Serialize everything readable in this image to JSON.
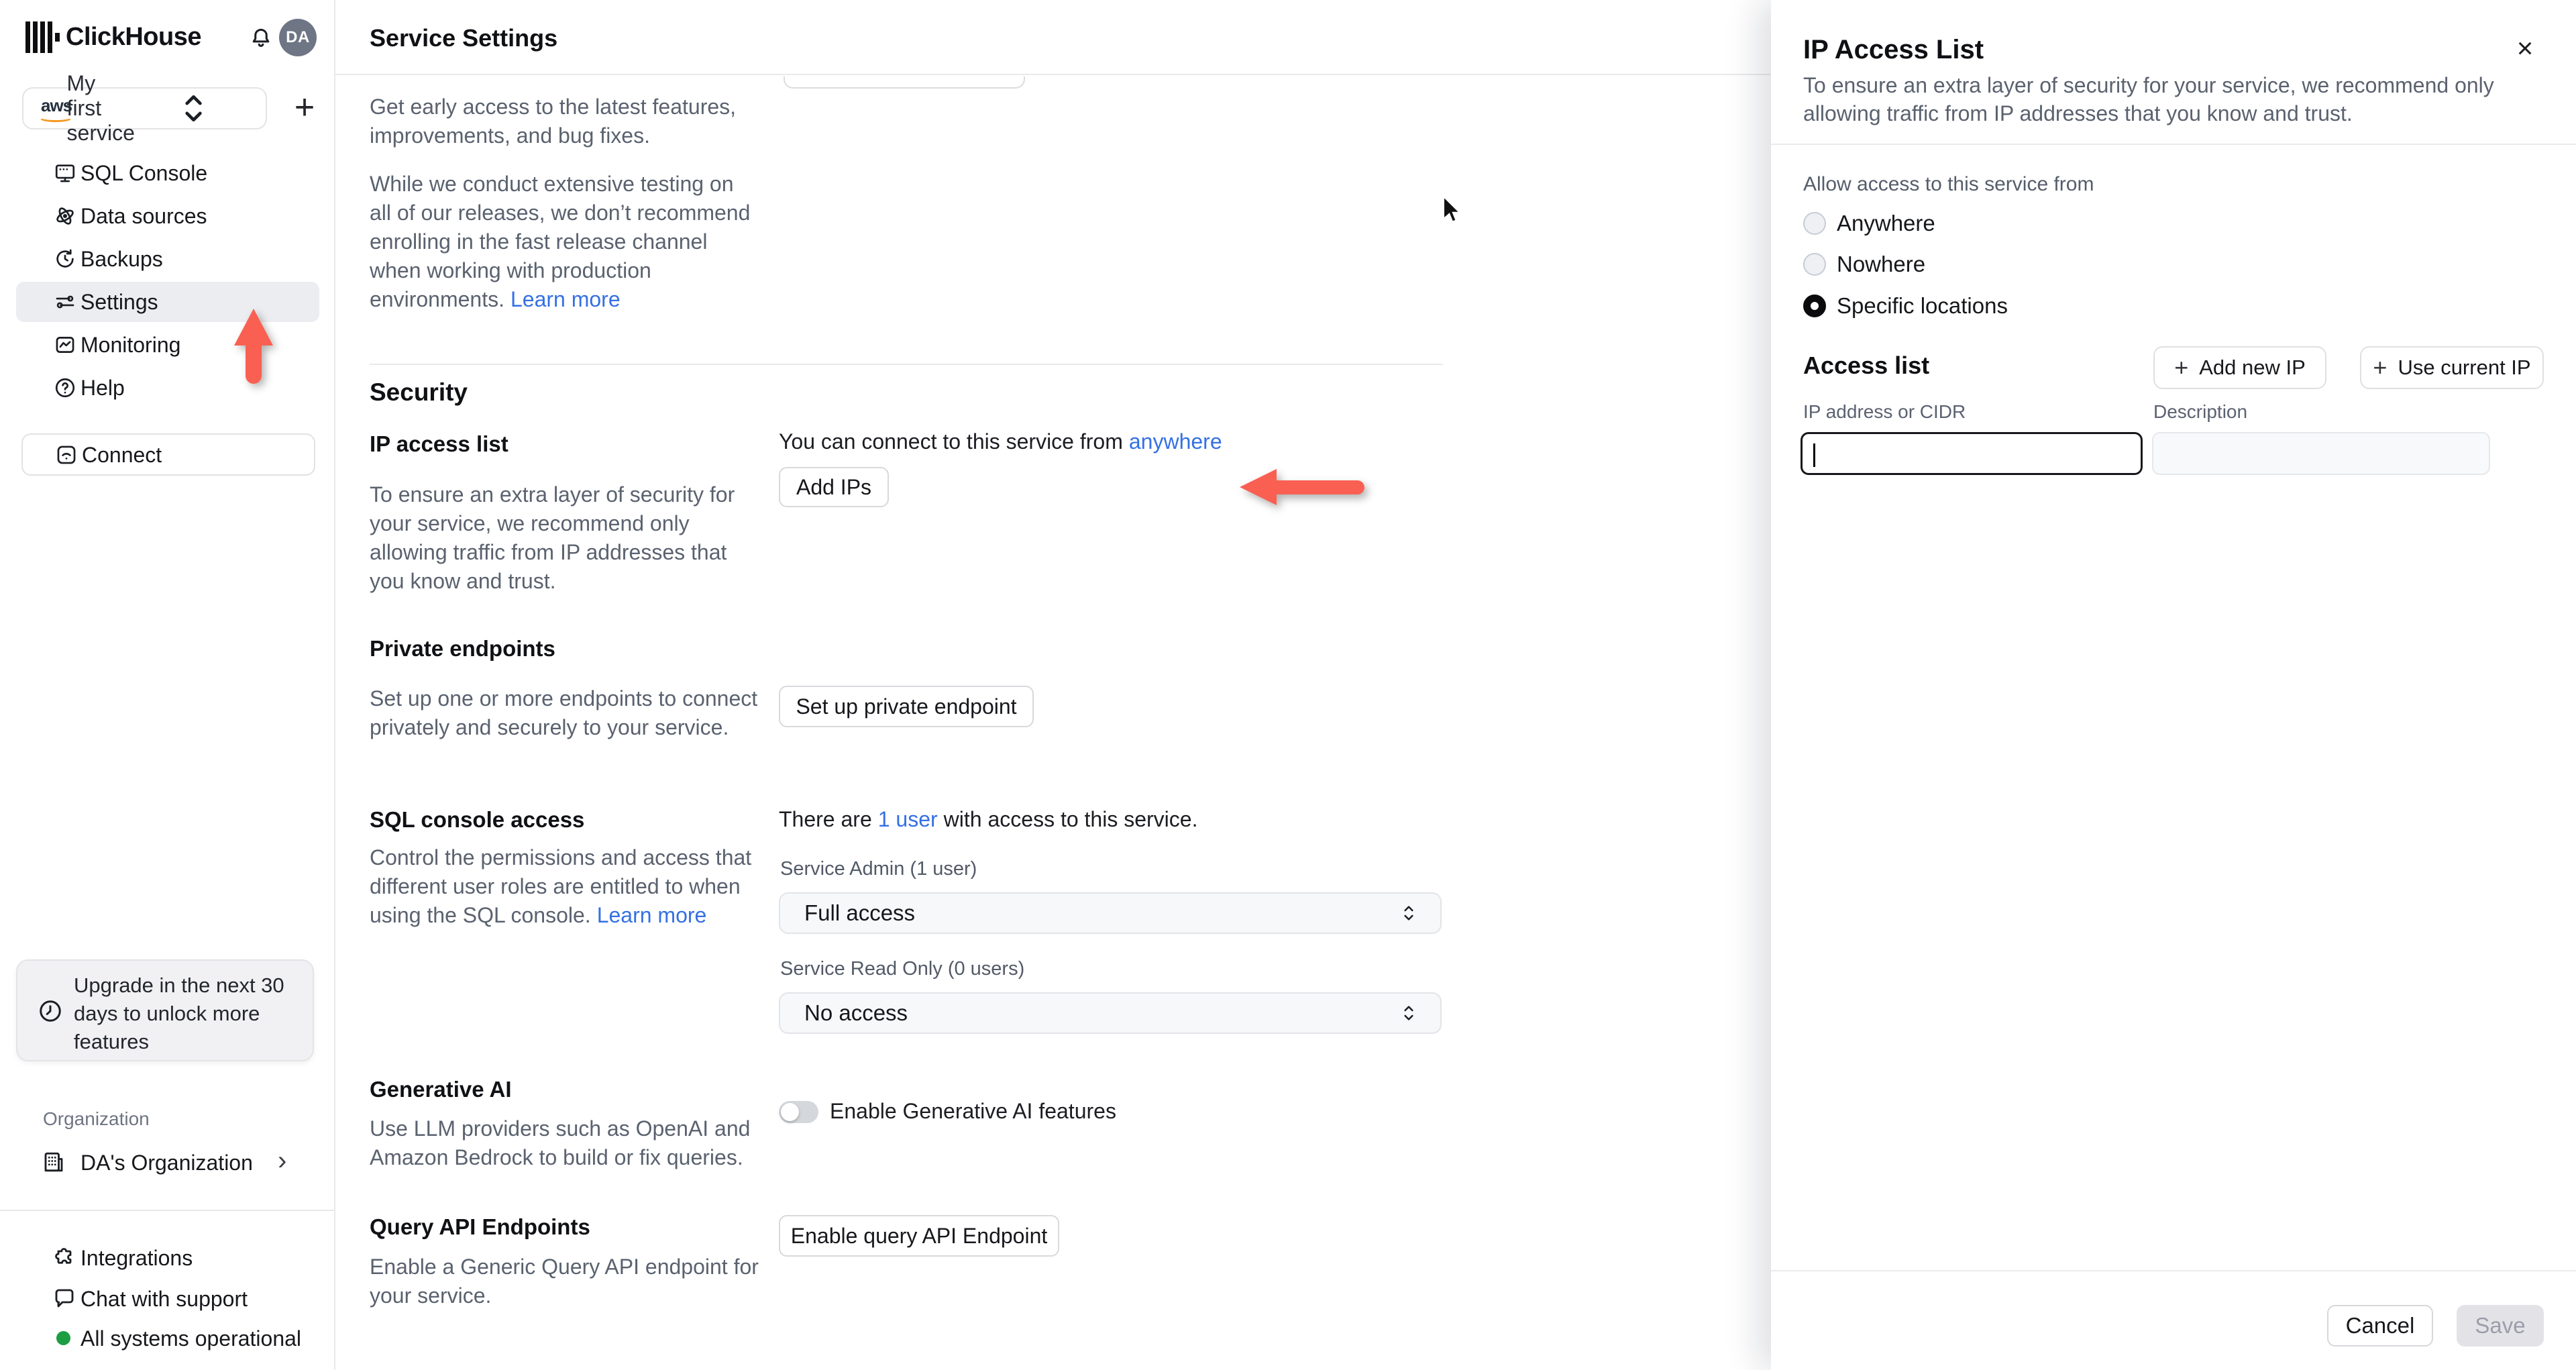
{
  "colors": {
    "accent_arrow": "#f96052",
    "link_blue": "#3470e4",
    "status_green": "#1d9e43",
    "nav_active_bg": "#ecedf0",
    "save_disabled_bg": "#e3e3e7"
  },
  "sidebar": {
    "brand": "ClickHouse",
    "avatar_initials": "DA",
    "notification_icon": "bell-icon",
    "service_selector": {
      "provider": "aws",
      "label": "My first service"
    },
    "add_service_label": "+",
    "nav": [
      {
        "label": "SQL Console",
        "active": false
      },
      {
        "label": "Data sources",
        "active": false
      },
      {
        "label": "Backups",
        "active": false
      },
      {
        "label": "Settings",
        "active": true
      },
      {
        "label": "Monitoring",
        "active": false
      },
      {
        "label": "Help",
        "active": false
      }
    ],
    "connect_label": "Connect",
    "upgrade_notice_lines": [
      "Upgrade in the next 30",
      "days to unlock more",
      "features"
    ],
    "organization_label": "Organization",
    "organization_name": "DA's Organization",
    "footer": {
      "integrations": "Integrations",
      "chat": "Chat with support",
      "status": "All systems operational"
    }
  },
  "header": {
    "title": "Service Settings"
  },
  "main": {
    "release_note_p1_lines": [
      "Get early access to the latest features,",
      "improvements, and bug fixes."
    ],
    "release_note_p2_lines": [
      "While we conduct extensive testing on",
      "all of our releases, we don’t recommend",
      "enrolling in the fast release channel",
      "when working with production",
      "environments."
    ],
    "release_note_link": "Learn more",
    "security_title": "Security",
    "ip_access": {
      "title": "IP access list",
      "desc_lines": [
        "To ensure an extra layer of security for",
        "your service, we recommend only",
        "allowing traffic from IP addresses that",
        "you know and trust."
      ],
      "status_prefix": "You can connect to this service from",
      "status_link": "anywhere",
      "add_ips_label": "Add IPs"
    },
    "private_endpoints": {
      "title": "Private endpoints",
      "desc_lines": [
        "Set up one or more endpoints to connect",
        "privately and securely to your service."
      ],
      "button_label": "Set up private endpoint"
    },
    "sql_access": {
      "title": "SQL console access",
      "desc_lines": [
        "Control the permissions and access that",
        "different user roles are entitled to when",
        "using the SQL console."
      ],
      "desc_link": "Learn more",
      "status_prefix": "There are",
      "status_link": "1 user",
      "status_suffix": "with access to this service.",
      "admin_label": "Service Admin (1 user)",
      "admin_value": "Full access",
      "readonly_label": "Service Read Only (0 users)",
      "readonly_value": "No access"
    },
    "generative_ai": {
      "title": "Generative AI",
      "desc_lines": [
        "Use LLM providers such as OpenAI and",
        "Amazon Bedrock to build or fix queries."
      ],
      "toggle_label": "Enable Generative AI features",
      "toggle_on": false
    },
    "query_api": {
      "title": "Query API Endpoints",
      "desc_lines": [
        "Enable a Generic Query API endpoint for",
        "your service."
      ],
      "button_label": "Enable query API Endpoint"
    }
  },
  "drawer": {
    "title": "IP Access List",
    "close_label": "×",
    "desc_lines": [
      "To ensure an extra layer of security for your service, we recommend only",
      "allowing traffic from IP addresses that you know and trust."
    ],
    "allow_label": "Allow access to this service from",
    "options": [
      {
        "label": "Anywhere",
        "selected": false
      },
      {
        "label": "Nowhere",
        "selected": false
      },
      {
        "label": "Specific locations",
        "selected": true
      }
    ],
    "access_list_title": "Access list",
    "plus_glyph": "+",
    "add_new_ip_label": "Add new IP",
    "use_current_ip_label": "Use current IP",
    "ip_field": {
      "label": "IP address or CIDR",
      "value": ""
    },
    "description_field": {
      "label": "Description",
      "value": ""
    },
    "cancel_label": "Cancel",
    "save_label": "Save"
  }
}
